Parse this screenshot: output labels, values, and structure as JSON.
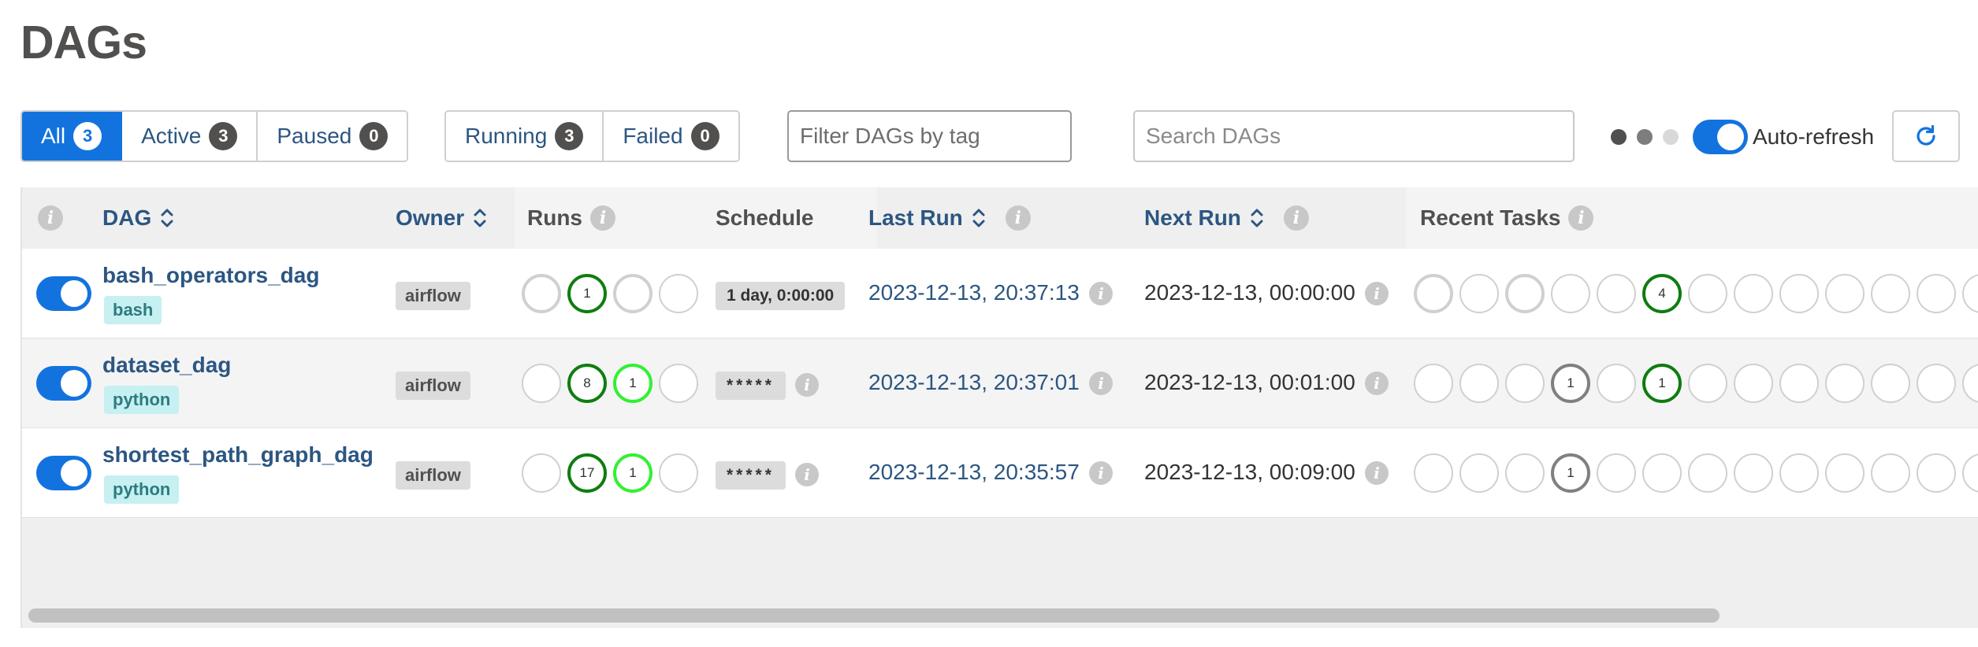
{
  "page": {
    "title": "DAGs"
  },
  "filters": {
    "status": [
      {
        "label": "All",
        "count": "3",
        "active": true
      },
      {
        "label": "Active",
        "count": "3",
        "active": false
      },
      {
        "label": "Paused",
        "count": "0",
        "active": false
      }
    ],
    "run_state": [
      {
        "label": "Running",
        "count": "3"
      },
      {
        "label": "Failed",
        "count": "0"
      }
    ],
    "tag_placeholder": "Filter DAGs by tag",
    "search_placeholder": "Search DAGs",
    "auto_refresh_label": "Auto-refresh",
    "loading_dot_colors": [
      "#51504f",
      "#7d7d7d",
      "#d9d9d9"
    ]
  },
  "table": {
    "headers": {
      "dag": "DAG",
      "owner": "Owner",
      "runs": "Runs",
      "schedule": "Schedule",
      "last_run": "Last Run",
      "next_run": "Next Run",
      "recent_tasks": "Recent Tasks"
    },
    "rows": [
      {
        "dag_id": "bash_operators_dag",
        "tag": "bash",
        "owner": "airflow",
        "runs": [
          {
            "state": "queued",
            "count": ""
          },
          {
            "state": "success",
            "count": "1"
          },
          {
            "state": "running",
            "count": ""
          },
          {
            "state": "failed",
            "count": ""
          }
        ],
        "schedule": "1 day, 0:00:00",
        "last_run": "2023-12-13, 20:37:13",
        "next_run": "2023-12-13, 00:00:00",
        "recent_tasks": [
          {
            "state": "none",
            "count": ""
          },
          {
            "state": "removed",
            "count": ""
          },
          {
            "state": "scheduled",
            "count": ""
          },
          {
            "state": "queued",
            "count": ""
          },
          {
            "state": "running",
            "count": ""
          },
          {
            "state": "success",
            "count": "4"
          },
          {
            "state": "restarting",
            "count": ""
          },
          {
            "state": "failed",
            "count": ""
          },
          {
            "state": "up_for_retry",
            "count": ""
          },
          {
            "state": "up_for_reschedule",
            "count": ""
          },
          {
            "state": "upstream_failed",
            "count": ""
          },
          {
            "state": "skipped",
            "count": ""
          },
          {
            "state": "deferred",
            "count": ""
          }
        ]
      },
      {
        "dag_id": "dataset_dag",
        "tag": "python",
        "owner": "airflow",
        "runs": [
          {
            "state": "queued",
            "count": ""
          },
          {
            "state": "success",
            "count": "8"
          },
          {
            "state": "running",
            "count": "1"
          },
          {
            "state": "failed",
            "count": ""
          }
        ],
        "schedule": "*****",
        "last_run": "2023-12-13, 20:37:01",
        "next_run": "2023-12-13, 00:01:00",
        "recent_tasks": [
          {
            "state": "none",
            "count": ""
          },
          {
            "state": "removed",
            "count": ""
          },
          {
            "state": "scheduled",
            "count": ""
          },
          {
            "state": "queued",
            "count": "1"
          },
          {
            "state": "running",
            "count": ""
          },
          {
            "state": "success",
            "count": "1"
          },
          {
            "state": "restarting",
            "count": ""
          },
          {
            "state": "failed",
            "count": ""
          },
          {
            "state": "up_for_retry",
            "count": ""
          },
          {
            "state": "up_for_reschedule",
            "count": ""
          },
          {
            "state": "upstream_failed",
            "count": ""
          },
          {
            "state": "skipped",
            "count": ""
          },
          {
            "state": "deferred",
            "count": ""
          }
        ]
      },
      {
        "dag_id": "shortest_path_graph_dag",
        "tag": "python",
        "owner": "airflow",
        "runs": [
          {
            "state": "queued",
            "count": ""
          },
          {
            "state": "success",
            "count": "17"
          },
          {
            "state": "running",
            "count": "1"
          },
          {
            "state": "failed",
            "count": ""
          }
        ],
        "schedule": "*****",
        "last_run": "2023-12-13, 20:35:57",
        "next_run": "2023-12-13, 00:09:00",
        "recent_tasks": [
          {
            "state": "none",
            "count": ""
          },
          {
            "state": "removed",
            "count": ""
          },
          {
            "state": "scheduled",
            "count": ""
          },
          {
            "state": "queued",
            "count": "1"
          },
          {
            "state": "running",
            "count": ""
          },
          {
            "state": "success",
            "count": ""
          },
          {
            "state": "restarting",
            "count": ""
          },
          {
            "state": "failed",
            "count": ""
          },
          {
            "state": "up_for_retry",
            "count": ""
          },
          {
            "state": "up_for_reschedule",
            "count": ""
          },
          {
            "state": "upstream_failed",
            "count": ""
          },
          {
            "state": "skipped",
            "count": ""
          },
          {
            "state": "deferred",
            "count": ""
          }
        ]
      }
    ]
  },
  "colors": {
    "accent": "#1373de",
    "link": "#2c5682",
    "success": "#0f7d0f",
    "running": "#32f032",
    "queued": "#808080"
  }
}
